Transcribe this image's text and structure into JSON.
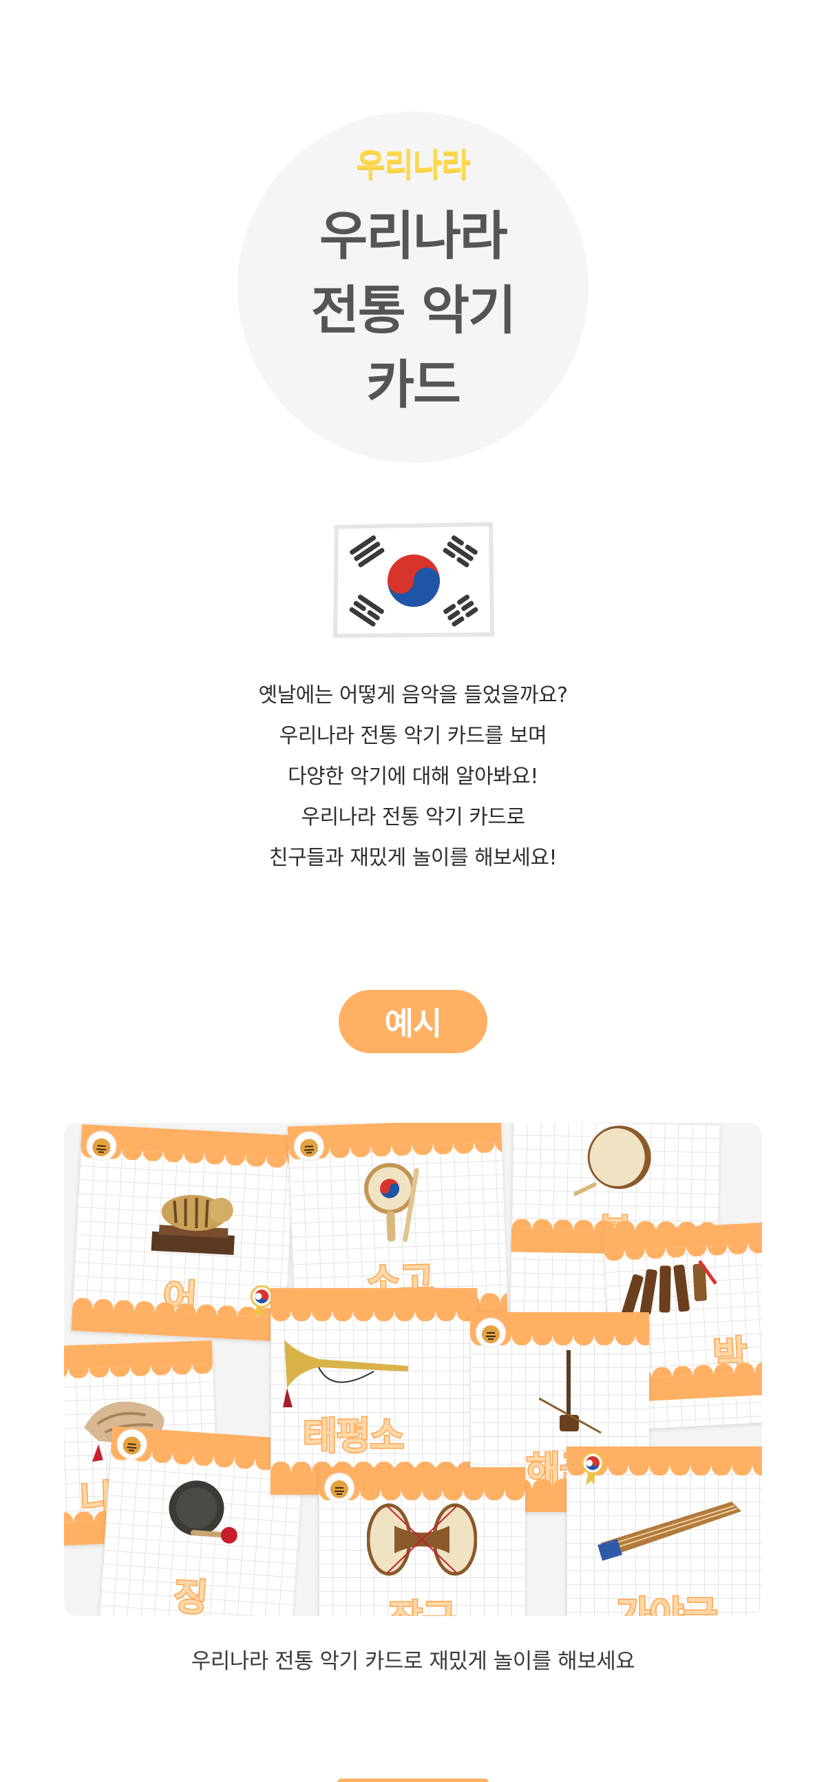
{
  "title": {
    "kicker": "우리나라",
    "line1": "우리나라",
    "line2": "전통 악기",
    "line3": "카드"
  },
  "intro": {
    "lines": [
      "옛날에는 어떻게 음악을 들었을까요?",
      "우리나라 전통 악기 카드를 보며",
      "다양한 악기에 대해 알아봐요!",
      "우리나라 전통 악기 카드로",
      "친구들과 재밌게 놀이를 해보세요!"
    ]
  },
  "example": {
    "label": "예시",
    "caption": "우리나라 전통 악기 카드로 재밌게 놀이를 해보세요",
    "cards": [
      {
        "label": "어",
        "icon": "eo-tiger-instrument-icon"
      },
      {
        "label": "소고",
        "icon": "sogo-hand-drum-icon"
      },
      {
        "label": "북",
        "icon": "buk-drum-icon"
      },
      {
        "label": "박",
        "icon": "bak-clapper-icon"
      },
      {
        "label": "나",
        "icon": "nagak-conch-icon"
      },
      {
        "label": "태평소",
        "icon": "taepyeongso-horn-icon"
      },
      {
        "label": "해금",
        "icon": "haegeum-fiddle-icon"
      },
      {
        "label": "징",
        "icon": "jing-gong-icon"
      },
      {
        "label": "장구",
        "icon": "janggu-drum-icon"
      },
      {
        "label": "가야금",
        "icon": "gayageum-zither-icon"
      }
    ]
  },
  "colors": {
    "accent": "#ffb062",
    "kicker": "#fdd94d",
    "title": "#555555",
    "circle": "#f5f5f5"
  }
}
